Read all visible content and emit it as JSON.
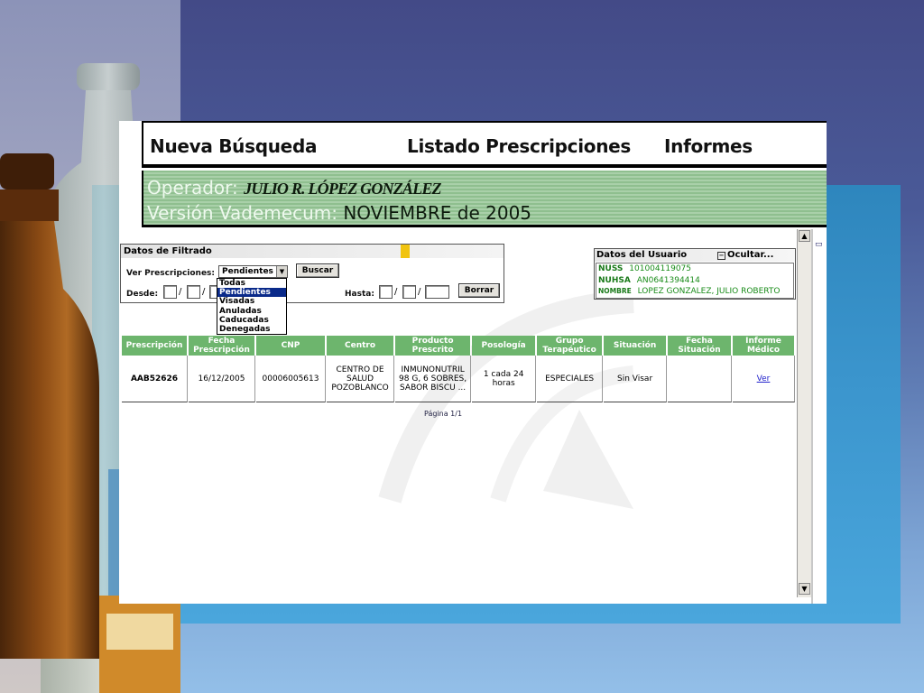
{
  "nav": {
    "nueva_busqueda": "Nueva Búsqueda",
    "listado": "Listado Prescripciones",
    "informes": "Informes"
  },
  "operator_bar": {
    "operador_label": "Operador:",
    "operador_name": "JULIO R. LÓPEZ GONZÁLEZ",
    "version_label": "Versión Vademecum:",
    "version_value": "NOVIEMBRE de 2005"
  },
  "filter": {
    "title": "Datos de Filtrado",
    "ver_label": "Ver Prescripciones:",
    "selected": "Pendientes",
    "buscar": "Buscar",
    "desde_label": "Desde:",
    "hasta_label": "Hasta:",
    "borrar": "Borrar",
    "options": [
      "Todas",
      "Pendientes",
      "Visadas",
      "Anuladas",
      "Caducadas",
      "Denegadas"
    ]
  },
  "user_panel": {
    "title": "Datos del Usuario",
    "hide": "Ocultar...",
    "nuss_label": "NUSS",
    "nuss_value": "101004119075",
    "nuhsa_label": "NUHSA",
    "nuhsa_value": "AN0641394414",
    "nombre_label": "NOMBRE",
    "nombre_value": "LOPEZ GONZALEZ, JULIO ROBERTO"
  },
  "table": {
    "headers": [
      "Prescripción",
      "Fecha Prescripción",
      "CNP",
      "Centro",
      "Producto Prescrito",
      "Posología",
      "Grupo Terapéutico",
      "Situación",
      "Fecha Situación",
      "Informe Médico"
    ],
    "rows": [
      {
        "prescripcion": "AAB52626",
        "fecha": "16/12/2005",
        "cnp": "00006005613",
        "centro": "CENTRO DE SALUD POZOBLANCO",
        "producto": "INMUNONUTRIL 98 G, 6 SOBRES, SABOR BISCU ...",
        "posologia": "1 cada 24 horas",
        "grupo": "ESPECIALES",
        "situacion": "Sin Visar",
        "fecha_situacion": "",
        "informe": "Ver"
      }
    ]
  },
  "pager": "Página 1/1",
  "colors": {
    "header_green": "#6db56d",
    "operator_bar": "#9ac79a",
    "user_text": "#1a8c1a",
    "selection": "#0a2a8a",
    "slide_blue": "#3b95cd"
  }
}
